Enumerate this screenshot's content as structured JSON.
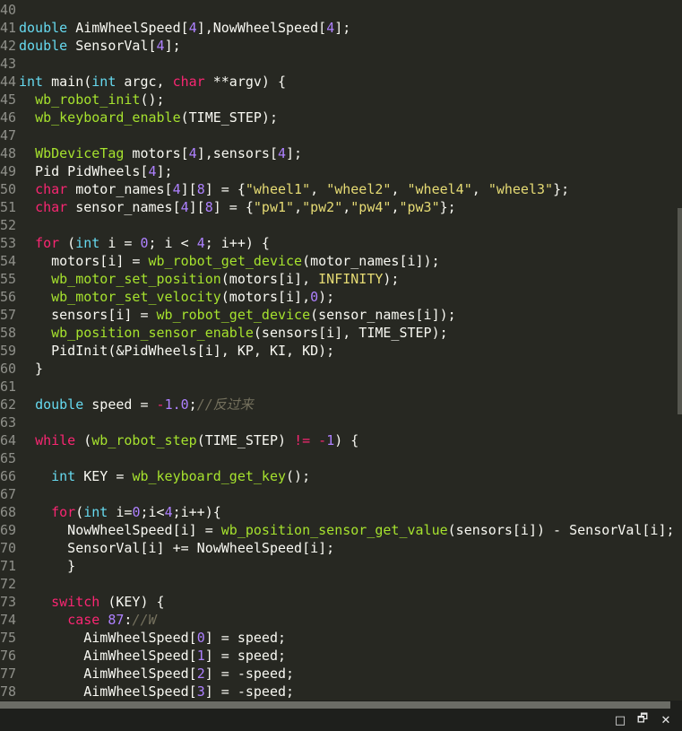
{
  "editor": {
    "lines": [
      {
        "n": "40",
        "tokens": []
      },
      {
        "n": "41",
        "tokens": [
          [
            "ty",
            "double"
          ],
          [
            "t",
            " AimWheelSpeed["
          ],
          [
            "num",
            "4"
          ],
          [
            "t",
            "],NowWheelSpeed["
          ],
          [
            "num",
            "4"
          ],
          [
            "t",
            "];"
          ]
        ]
      },
      {
        "n": "42",
        "tokens": [
          [
            "ty",
            "double"
          ],
          [
            "t",
            " SensorVal["
          ],
          [
            "num",
            "4"
          ],
          [
            "t",
            "];"
          ]
        ]
      },
      {
        "n": "43",
        "tokens": []
      },
      {
        "n": "44",
        "tokens": [
          [
            "ty",
            "int"
          ],
          [
            "t",
            " main("
          ],
          [
            "ty",
            "int"
          ],
          [
            "t",
            " argc, "
          ],
          [
            "kw",
            "char"
          ],
          [
            "t",
            " **argv) {"
          ]
        ]
      },
      {
        "n": "45",
        "tokens": [
          [
            "t",
            "  "
          ],
          [
            "fn",
            "wb_robot_init"
          ],
          [
            "t",
            "();"
          ]
        ]
      },
      {
        "n": "46",
        "tokens": [
          [
            "t",
            "  "
          ],
          [
            "fn",
            "wb_keyboard_enable"
          ],
          [
            "t",
            "(TIME_STEP);"
          ]
        ]
      },
      {
        "n": "47",
        "tokens": []
      },
      {
        "n": "48",
        "tokens": [
          [
            "t",
            "  "
          ],
          [
            "fn",
            "WbDeviceTag"
          ],
          [
            "t",
            " motors["
          ],
          [
            "num",
            "4"
          ],
          [
            "t",
            "],sensors["
          ],
          [
            "num",
            "4"
          ],
          [
            "t",
            "];"
          ]
        ]
      },
      {
        "n": "49",
        "tokens": [
          [
            "t",
            "  Pid PidWheels["
          ],
          [
            "num",
            "4"
          ],
          [
            "t",
            "];"
          ]
        ]
      },
      {
        "n": "50",
        "tokens": [
          [
            "t",
            "  "
          ],
          [
            "kw",
            "char"
          ],
          [
            "t",
            " motor_names["
          ],
          [
            "num",
            "4"
          ],
          [
            "t",
            "]["
          ],
          [
            "num",
            "8"
          ],
          [
            "t",
            "] = {"
          ],
          [
            "str",
            "\"wheel1\""
          ],
          [
            "t",
            ", "
          ],
          [
            "str",
            "\"wheel2\""
          ],
          [
            "t",
            ", "
          ],
          [
            "str",
            "\"wheel4\""
          ],
          [
            "t",
            ", "
          ],
          [
            "str",
            "\"wheel3\""
          ],
          [
            "t",
            "};"
          ]
        ]
      },
      {
        "n": "51",
        "tokens": [
          [
            "t",
            "  "
          ],
          [
            "kw",
            "char"
          ],
          [
            "t",
            " sensor_names["
          ],
          [
            "num",
            "4"
          ],
          [
            "t",
            "]["
          ],
          [
            "num",
            "8"
          ],
          [
            "t",
            "] = {"
          ],
          [
            "str",
            "\"pw1\""
          ],
          [
            "t",
            ","
          ],
          [
            "str",
            "\"pw2\""
          ],
          [
            "t",
            ","
          ],
          [
            "str",
            "\"pw4\""
          ],
          [
            "t",
            ","
          ],
          [
            "str",
            "\"pw3\""
          ],
          [
            "t",
            "};"
          ]
        ]
      },
      {
        "n": "52",
        "tokens": []
      },
      {
        "n": "53",
        "tokens": [
          [
            "t",
            "  "
          ],
          [
            "kw",
            "for"
          ],
          [
            "t",
            " ("
          ],
          [
            "ty",
            "int"
          ],
          [
            "t",
            " i = "
          ],
          [
            "num",
            "0"
          ],
          [
            "t",
            "; i < "
          ],
          [
            "num",
            "4"
          ],
          [
            "t",
            "; i++) {"
          ]
        ]
      },
      {
        "n": "54",
        "tokens": [
          [
            "t",
            "    motors[i] = "
          ],
          [
            "fn",
            "wb_robot_get_device"
          ],
          [
            "t",
            "(motor_names[i]);"
          ]
        ]
      },
      {
        "n": "55",
        "tokens": [
          [
            "t",
            "    "
          ],
          [
            "fn",
            "wb_motor_set_position"
          ],
          [
            "t",
            "(motors[i], "
          ],
          [
            "cst",
            "INFINITY"
          ],
          [
            "t",
            ");"
          ]
        ]
      },
      {
        "n": "56",
        "tokens": [
          [
            "t",
            "    "
          ],
          [
            "fn",
            "wb_motor_set_velocity"
          ],
          [
            "t",
            "(motors[i],"
          ],
          [
            "num",
            "0"
          ],
          [
            "t",
            ");"
          ]
        ]
      },
      {
        "n": "57",
        "tokens": [
          [
            "t",
            "    sensors[i] = "
          ],
          [
            "fn",
            "wb_robot_get_device"
          ],
          [
            "t",
            "(sensor_names[i]);"
          ]
        ]
      },
      {
        "n": "58",
        "tokens": [
          [
            "t",
            "    "
          ],
          [
            "fn",
            "wb_position_sensor_enable"
          ],
          [
            "t",
            "(sensors[i], TIME_STEP);"
          ]
        ]
      },
      {
        "n": "59",
        "tokens": [
          [
            "t",
            "    PidInit(&PidWheels[i], KP, KI, KD);"
          ]
        ]
      },
      {
        "n": "60",
        "tokens": [
          [
            "t",
            "  }"
          ]
        ]
      },
      {
        "n": "61",
        "tokens": []
      },
      {
        "n": "62",
        "tokens": [
          [
            "t",
            "  "
          ],
          [
            "ty",
            "double"
          ],
          [
            "t",
            " speed = "
          ],
          [
            "kw",
            "-"
          ],
          [
            "num",
            "1.0"
          ],
          [
            "t",
            ";"
          ],
          [
            "cm",
            "//反过来"
          ]
        ]
      },
      {
        "n": "63",
        "tokens": []
      },
      {
        "n": "64",
        "tokens": [
          [
            "t",
            "  "
          ],
          [
            "kw",
            "while"
          ],
          [
            "t",
            " ("
          ],
          [
            "fn",
            "wb_robot_step"
          ],
          [
            "t",
            "(TIME_STEP) "
          ],
          [
            "kw",
            "!="
          ],
          [
            "t",
            " "
          ],
          [
            "kw",
            "-"
          ],
          [
            "num",
            "1"
          ],
          [
            "t",
            ") {"
          ]
        ]
      },
      {
        "n": "65",
        "tokens": []
      },
      {
        "n": "66",
        "tokens": [
          [
            "t",
            "    "
          ],
          [
            "ty",
            "int"
          ],
          [
            "t",
            " KEY = "
          ],
          [
            "fn",
            "wb_keyboard_get_key"
          ],
          [
            "t",
            "();"
          ]
        ]
      },
      {
        "n": "67",
        "tokens": []
      },
      {
        "n": "68",
        "tokens": [
          [
            "t",
            "    "
          ],
          [
            "kw",
            "for"
          ],
          [
            "t",
            "("
          ],
          [
            "ty",
            "int"
          ],
          [
            "t",
            " i="
          ],
          [
            "num",
            "0"
          ],
          [
            "t",
            ";i<"
          ],
          [
            "num",
            "4"
          ],
          [
            "t",
            ";i++){"
          ]
        ]
      },
      {
        "n": "69",
        "tokens": [
          [
            "t",
            "      NowWheelSpeed[i] = "
          ],
          [
            "fn",
            "wb_position_sensor_get_value"
          ],
          [
            "t",
            "(sensors[i]) - SensorVal[i];"
          ]
        ]
      },
      {
        "n": "70",
        "tokens": [
          [
            "t",
            "      SensorVal[i] += NowWheelSpeed[i];"
          ]
        ]
      },
      {
        "n": "71",
        "tokens": [
          [
            "t",
            "      }"
          ]
        ]
      },
      {
        "n": "72",
        "tokens": []
      },
      {
        "n": "73",
        "tokens": [
          [
            "t",
            "    "
          ],
          [
            "kw",
            "switch"
          ],
          [
            "t",
            " (KEY) {"
          ]
        ]
      },
      {
        "n": "74",
        "tokens": [
          [
            "t",
            "      "
          ],
          [
            "kw",
            "case"
          ],
          [
            "t",
            " "
          ],
          [
            "num",
            "87"
          ],
          [
            "t",
            ":"
          ],
          [
            "cm",
            "//W"
          ]
        ]
      },
      {
        "n": "75",
        "tokens": [
          [
            "t",
            "        AimWheelSpeed["
          ],
          [
            "num",
            "0"
          ],
          [
            "t",
            "] = speed;"
          ]
        ]
      },
      {
        "n": "76",
        "tokens": [
          [
            "t",
            "        AimWheelSpeed["
          ],
          [
            "num",
            "1"
          ],
          [
            "t",
            "] = speed;"
          ]
        ]
      },
      {
        "n": "77",
        "tokens": [
          [
            "t",
            "        AimWheelSpeed["
          ],
          [
            "num",
            "2"
          ],
          [
            "t",
            "] = -speed;"
          ]
        ]
      },
      {
        "n": "78",
        "tokens": [
          [
            "t",
            "        AimWheelSpeed["
          ],
          [
            "num",
            "3"
          ],
          [
            "t",
            "] = -speed;"
          ]
        ]
      }
    ]
  },
  "window_controls": {
    "minimize": "□",
    "restore": "🗗",
    "close": "✕"
  },
  "colors": {
    "background": "#272822",
    "keyword": "#f92672",
    "type": "#66d9ef",
    "function": "#a6e22e",
    "number": "#ae81ff",
    "string": "#e6db74",
    "comment": "#75715e"
  }
}
